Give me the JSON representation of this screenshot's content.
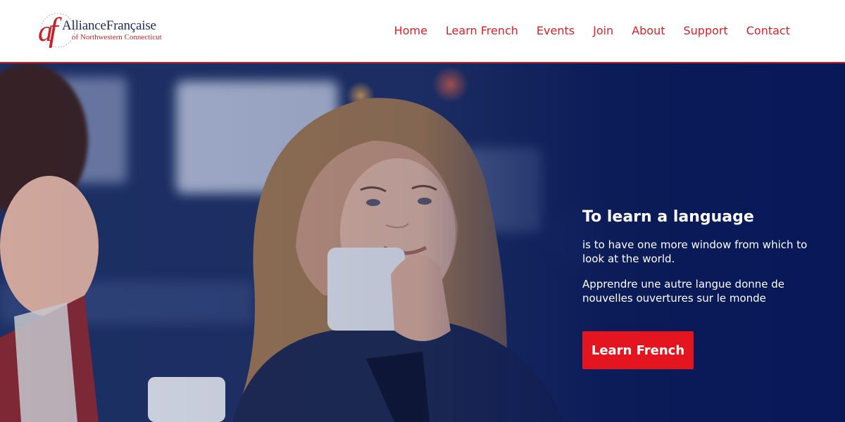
{
  "brand": {
    "name": "AllianceFrançaise",
    "subtitle": "of Northwestern Connecticut",
    "colors": {
      "red": "#d81f26",
      "navy": "#1d2a5c",
      "button": "#e4151f"
    }
  },
  "nav": {
    "items": [
      {
        "label": "Home"
      },
      {
        "label": "Learn French"
      },
      {
        "label": "Events"
      },
      {
        "label": "Join"
      },
      {
        "label": "About"
      },
      {
        "label": "Support"
      },
      {
        "label": "Contact"
      }
    ]
  },
  "hero": {
    "heading": "To learn a language",
    "paragraph1": "is to have one more window from which to look at the world.",
    "paragraph2": "Apprendre une autre langue donne de nouvelles ouvertures sur le monde",
    "cta_label": "Learn French"
  }
}
